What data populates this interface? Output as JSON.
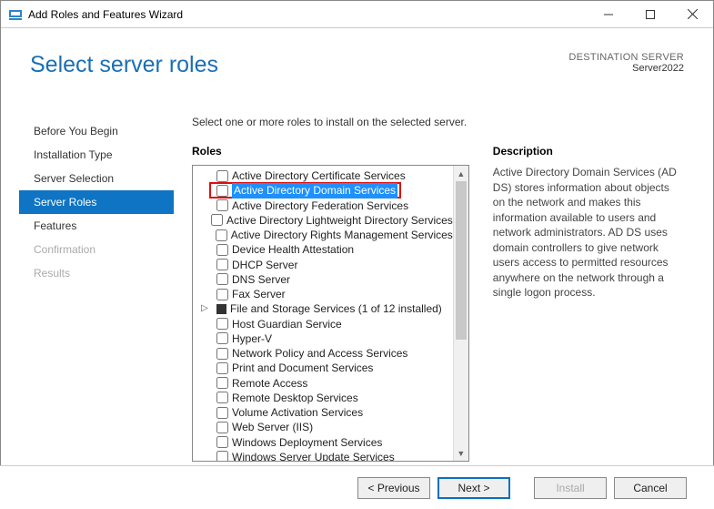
{
  "window": {
    "title": "Add Roles and Features Wizard"
  },
  "header": {
    "pageTitle": "Select server roles",
    "destLabel": "DESTINATION SERVER",
    "destName": "Server2022"
  },
  "sidebar": {
    "items": [
      {
        "label": "Before You Begin",
        "state": "normal"
      },
      {
        "label": "Installation Type",
        "state": "normal"
      },
      {
        "label": "Server Selection",
        "state": "normal"
      },
      {
        "label": "Server Roles",
        "state": "selected"
      },
      {
        "label": "Features",
        "state": "normal"
      },
      {
        "label": "Confirmation",
        "state": "disabled"
      },
      {
        "label": "Results",
        "state": "disabled"
      }
    ]
  },
  "main": {
    "instruction": "Select one or more roles to install on the selected server.",
    "rolesHeading": "Roles",
    "descHeading": "Description",
    "descText": "Active Directory Domain Services (AD DS) stores information about objects on the network and makes this information available to users and network administrators. AD DS uses domain controllers to give network users access to permitted resources anywhere on the network through a single logon process.",
    "roles": [
      {
        "label": "Active Directory Certificate Services",
        "checked": false
      },
      {
        "label": "Active Directory Domain Services",
        "checked": false,
        "highlighted": true
      },
      {
        "label": "Active Directory Federation Services",
        "checked": false
      },
      {
        "label": "Active Directory Lightweight Directory Services",
        "checked": false
      },
      {
        "label": "Active Directory Rights Management Services",
        "checked": false
      },
      {
        "label": "Device Health Attestation",
        "checked": false
      },
      {
        "label": "DHCP Server",
        "checked": false
      },
      {
        "label": "DNS Server",
        "checked": false
      },
      {
        "label": "Fax Server",
        "checked": false
      },
      {
        "label": "File and Storage Services (1 of 12 installed)",
        "checked": "partial",
        "expandable": true
      },
      {
        "label": "Host Guardian Service",
        "checked": false
      },
      {
        "label": "Hyper-V",
        "checked": false
      },
      {
        "label": "Network Policy and Access Services",
        "checked": false
      },
      {
        "label": "Print and Document Services",
        "checked": false
      },
      {
        "label": "Remote Access",
        "checked": false
      },
      {
        "label": "Remote Desktop Services",
        "checked": false
      },
      {
        "label": "Volume Activation Services",
        "checked": false
      },
      {
        "label": "Web Server (IIS)",
        "checked": false
      },
      {
        "label": "Windows Deployment Services",
        "checked": false
      },
      {
        "label": "Windows Server Update Services",
        "checked": false
      }
    ]
  },
  "footer": {
    "previous": "< Previous",
    "next": "Next >",
    "install": "Install",
    "cancel": "Cancel"
  }
}
